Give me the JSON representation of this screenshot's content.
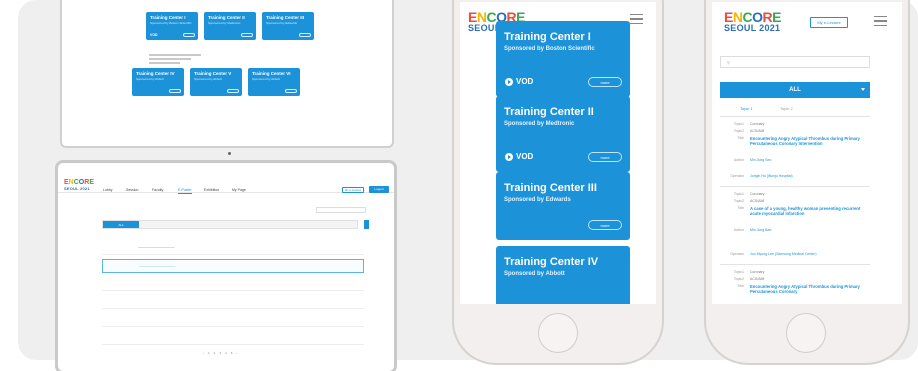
{
  "colors": {
    "accent": "#1c93d9",
    "background": "#efefef",
    "brand_logo": [
      "#e94e3c",
      "#f4b400",
      "#3aa757",
      "#2a6fb6"
    ]
  },
  "laptop_top": {
    "cards": [
      {
        "title": "Training Center I",
        "sub": "Sponsored by Boston Scientific",
        "action": "VOD"
      },
      {
        "title": "Training Center II",
        "sub": "Sponsored by Medtronic",
        "action": "VOD"
      },
      {
        "title": "Training Center III",
        "sub": "Sponsored by Edwards",
        "action": ""
      },
      {
        "title": "Training Center IV",
        "sub": "Sponsored by Abbott",
        "action": ""
      },
      {
        "title": "Training Center V",
        "sub": "Sponsored by Abbott",
        "action": ""
      },
      {
        "title": "Training Center VI",
        "sub": "Sponsored by Abbott",
        "action": ""
      }
    ]
  },
  "laptop": {
    "logo": {
      "word": "ENCORE",
      "sub": "SEOUL 2021"
    },
    "nav": [
      "Lobby",
      "Session",
      "Faculty",
      "E-Poster",
      "Exhibition",
      "My Page"
    ],
    "btn_outline": "My e-Lecture",
    "btn_solid": "Logout",
    "tabs": [
      "ALL",
      "",
      "",
      "",
      "",
      "",
      ""
    ],
    "pager": [
      "‹",
      "1",
      "2",
      "3",
      "4",
      "5",
      "›"
    ]
  },
  "phone1": {
    "logo": {
      "word": "ENCORE",
      "sub": "SEOUL 2021"
    },
    "cards": [
      {
        "title": "Training Center I",
        "sub": "Sponsored by Boston Scientific",
        "vod": "VOD",
        "more": "more"
      },
      {
        "title": "Training Center II",
        "sub": "Sponsored by Medtronic",
        "vod": "VOD",
        "more": "more"
      },
      {
        "title": "Training Center III",
        "sub": "Sponsored by Edwards",
        "vod": "",
        "more": "more"
      },
      {
        "title": "Training Center IV",
        "sub": "Sponsored by Abbott",
        "vod": "",
        "more": ""
      }
    ]
  },
  "phone2": {
    "logo": {
      "word": "ENCORE",
      "sub": "SEOUL 2021"
    },
    "btn": "My e-Lecture",
    "all_label": "ALL",
    "topics": [
      "Topic 1",
      "Topic 2"
    ],
    "entries": [
      {
        "k1": "Topic1",
        "v1": "Coronary",
        "k2": "Topic2",
        "v2": "ACS/AMI",
        "k3": "Title",
        "v3": "Encountering Angry Atypical Thrombus during Primary Percutaneous Coronary Intervention",
        "k4": "Author",
        "v4": "Min Jung Seo",
        "k5": "Operator",
        "v5": "Jongin Ho (Wonju Hospital)"
      },
      {
        "k1": "Topic1",
        "v1": "Coronary",
        "k2": "Topic2",
        "v2": "ACS/AMI",
        "k3": "Title",
        "v3": "A case of a young, healthy woman presenting recurrent acute myocardial infarction",
        "k4": "Author",
        "v4": "Min Jung Bae",
        "k5": "Operator",
        "v5": "Joo Myung Lee (Samsung Medical Center)"
      },
      {
        "k1": "Topic1",
        "v1": "Coronary",
        "k2": "Topic2",
        "v2": "ACS/AMI",
        "k3": "Title",
        "v3": "Encountering Angry Atypical Thrombus during Primary Percutaneous Coronary",
        "k4": "",
        "v4": "",
        "k5": "",
        "v5": ""
      }
    ]
  }
}
